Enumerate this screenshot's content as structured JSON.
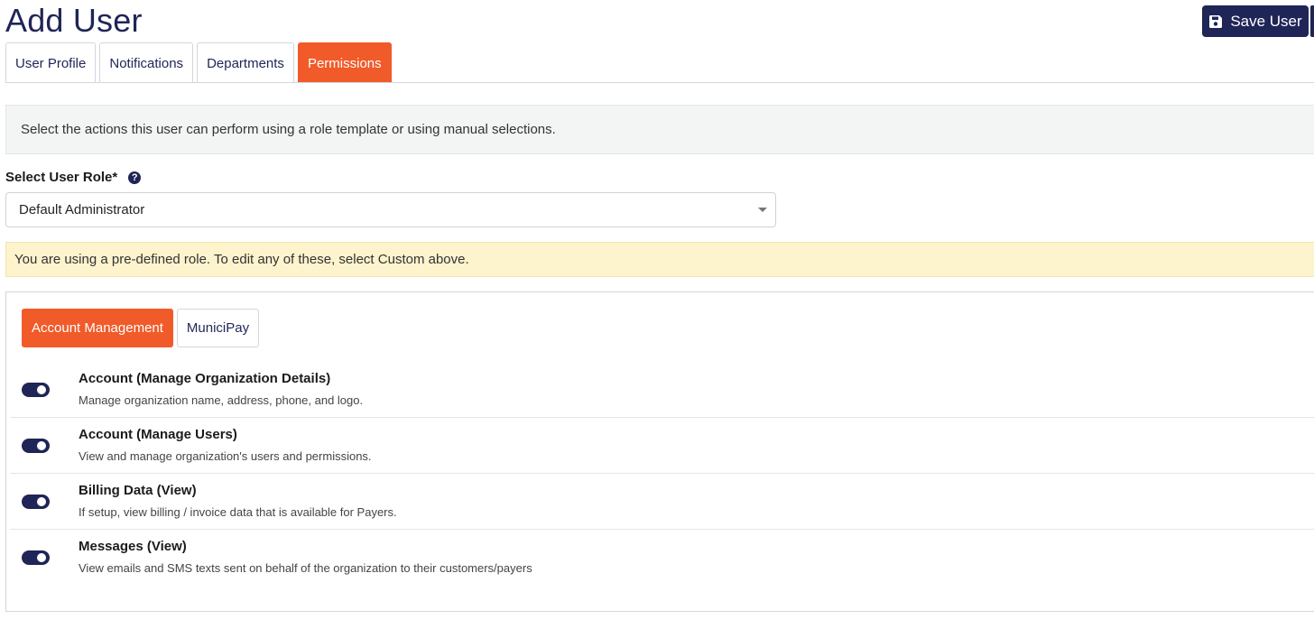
{
  "page": {
    "title": "Add User"
  },
  "header": {
    "save_label": "Save User",
    "save_icon": "floppy-disk-icon"
  },
  "tabs": [
    {
      "label": "User Profile",
      "active": false
    },
    {
      "label": "Notifications",
      "active": false
    },
    {
      "label": "Departments",
      "active": false
    },
    {
      "label": "Permissions",
      "active": true
    }
  ],
  "info": {
    "text": "Select the actions this user can perform using a role template or using manual selections."
  },
  "role": {
    "label": "Select User Role*",
    "help_icon": "question-circle-icon",
    "selected": "Default Administrator"
  },
  "warning": {
    "text": "You are using a pre-defined role. To edit any of these, select Custom above."
  },
  "subtabs": [
    {
      "label": "Account Management",
      "active": true
    },
    {
      "label": "MuniciPay",
      "active": false
    }
  ],
  "permissions": [
    {
      "title": "Account (Manage Organization Details)",
      "description": "Manage organization name, address, phone, and logo.",
      "enabled": true
    },
    {
      "title": "Account (Manage Users)",
      "description": "View and manage organization's users and permissions.",
      "enabled": true
    },
    {
      "title": "Billing Data (View)",
      "description": "If setup, view billing / invoice data that is available for Payers.",
      "enabled": true
    },
    {
      "title": "Messages (View)",
      "description": "View emails and SMS texts sent on behalf of the organization to their customers/payers",
      "enabled": true
    }
  ],
  "colors": {
    "navy": "#1f2557",
    "accent": "#f15a29",
    "warning_bg": "#fdf3cd",
    "info_bg": "#f3f4f4"
  }
}
